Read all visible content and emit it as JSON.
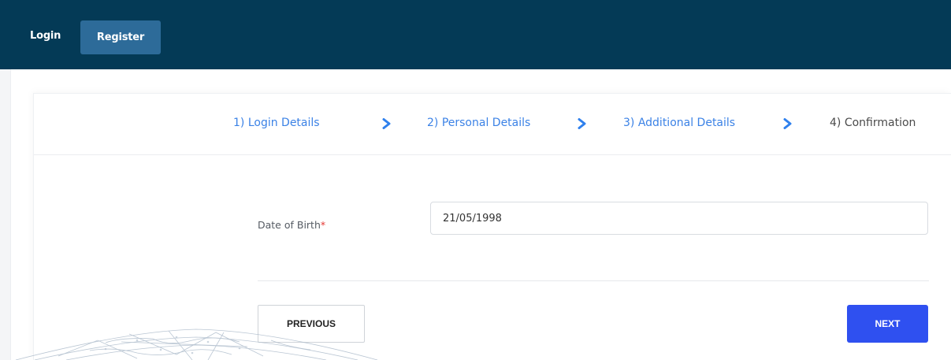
{
  "nav": {
    "login_label": "Login",
    "register_label": "Register"
  },
  "steps": [
    {
      "label": "1) Login Details",
      "state": "link"
    },
    {
      "label": "2) Personal Details",
      "state": "link"
    },
    {
      "label": "3) Additional Details",
      "state": "link"
    },
    {
      "label": "4) Confirmation",
      "state": "current"
    }
  ],
  "form": {
    "dob_label": "Date of Birth",
    "required_marker": "*",
    "dob_value": "21/05/1998"
  },
  "buttons": {
    "previous_label": "PREVIOUS",
    "next_label": "NEXT"
  },
  "icons": {
    "step_separator": "chevron-right-icon",
    "background": "globe-map-icon"
  },
  "colors": {
    "navbar": "#043a56",
    "register_bg": "#2d6b99",
    "step_link": "#3b82e6",
    "chevron": "#2f80ed",
    "next_button": "#2f50f0",
    "required": "#e53935"
  }
}
